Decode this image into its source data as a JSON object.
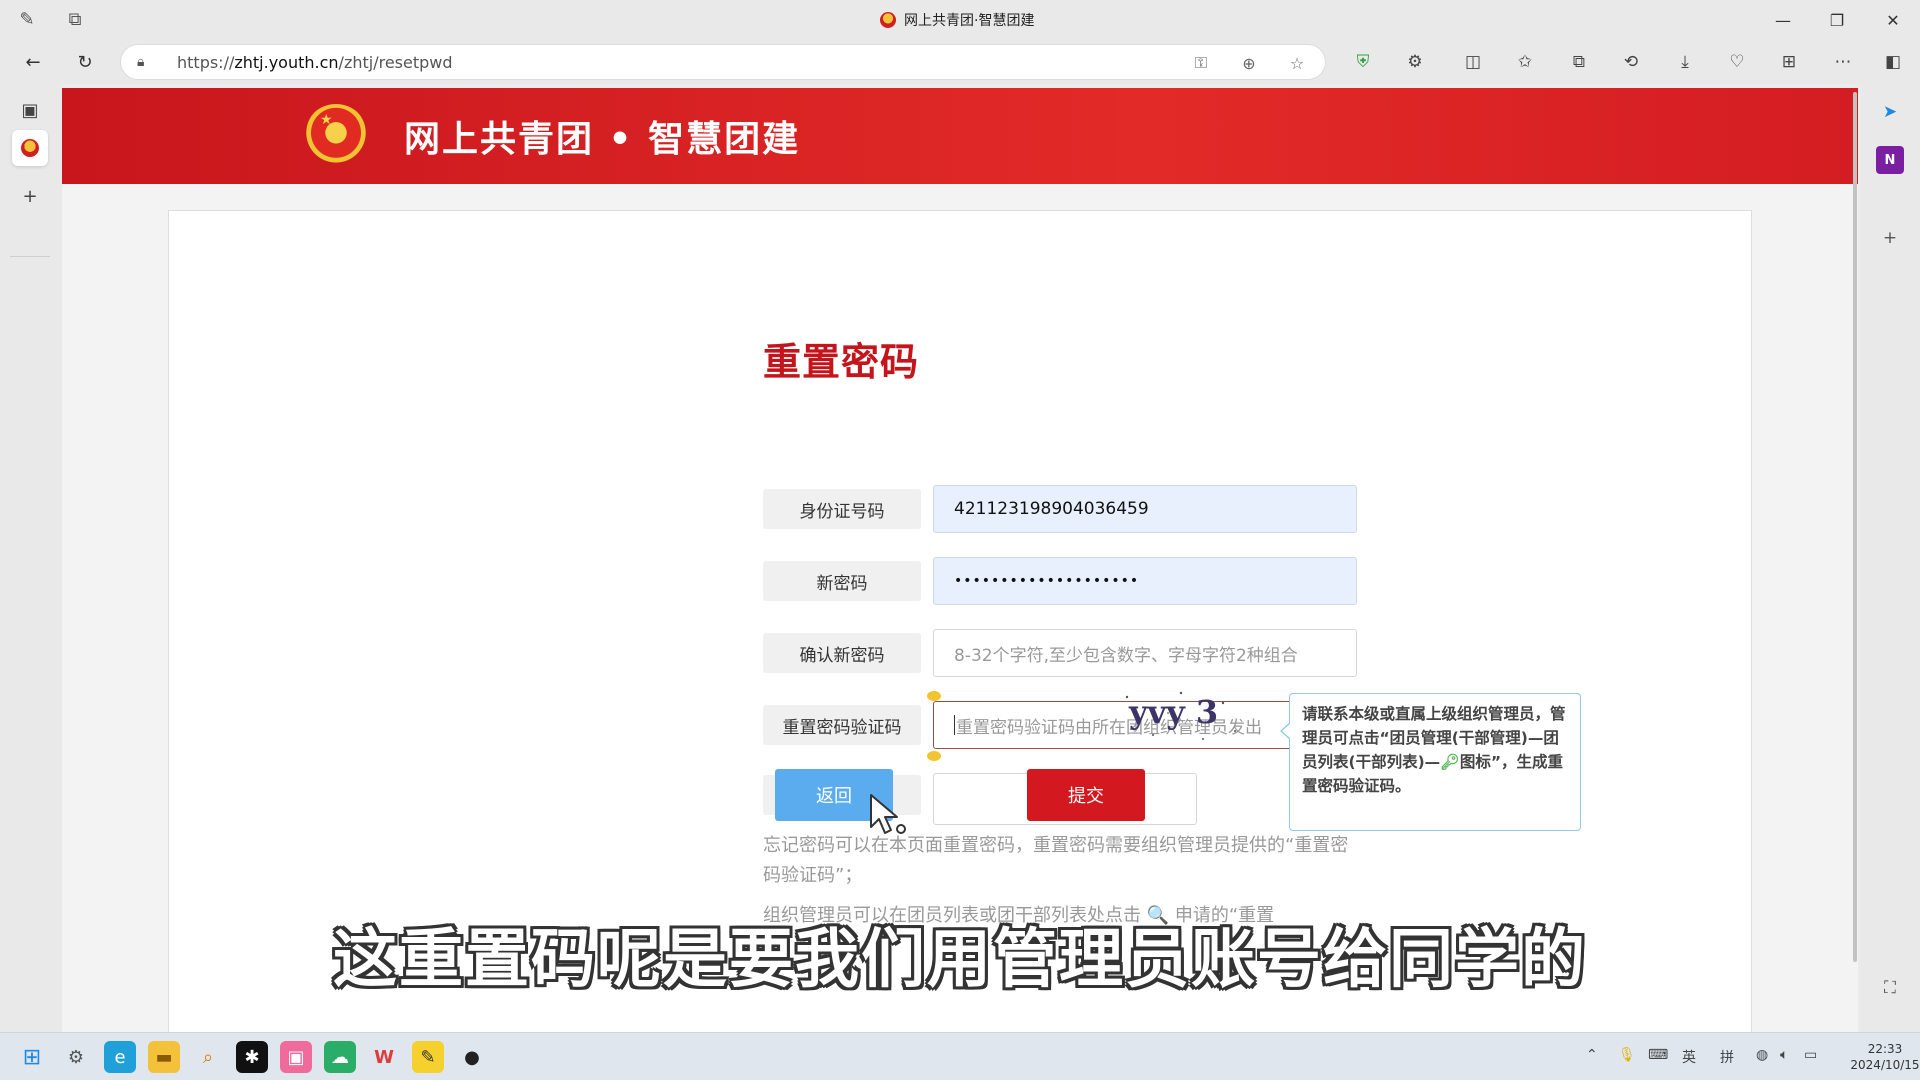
{
  "browser": {
    "tab_title": "网上共青团·智慧团建",
    "url_prefix": "https://",
    "url_host": "zhtj.youth.cn",
    "url_path": "/zhtj/resetpwd",
    "icons": {
      "back": "arrow-left-icon",
      "refresh": "refresh-icon",
      "lock": "lock-icon",
      "favorite": "star-icon",
      "zoom": "zoom-icon",
      "key": "key-icon"
    },
    "window_controls": [
      "—",
      "❐",
      "✕"
    ]
  },
  "header": {
    "site_title": "网上共青团 • 智慧团建"
  },
  "form": {
    "title": "重置密码",
    "id_label": "身份证号码",
    "id_value": "421123198904036459",
    "new_pw_label": "新密码",
    "new_pw_value": "••••••••••••••••••••",
    "confirm_pw_label": "确认新密码",
    "confirm_pw_placeholder": "8-32个字符,至少包含数字、字母字符2种组合",
    "reset_code_label": "重置密码验证码",
    "reset_code_placeholder": "重置密码验证码由所在团组织管理员发出",
    "captcha_label": "验证码",
    "captcha_value": "",
    "captcha_image_text": "yvy 3",
    "back_button": "返回",
    "submit_button": "提交"
  },
  "tooltip": {
    "line1": "请联系本级或直属上级组织管理员，管理员可点击“团员管理(干部管理)—团员列表(干部列表)—",
    "line2": "图标”，生成重置密码验证码。"
  },
  "help": {
    "p1": "忘记密码可以在本页面重置密码，重置密码需要组织管理员提供的“重置密码验证码”；",
    "p2": "组织管理员可以在团员列表或团干部列表处点击 🔍 申请的“重置"
  },
  "subtitle": "这重置码呢是要我们用管理员账号给同学的",
  "taskbar": {
    "tray_ime": "英",
    "tray_pinyin": "拼",
    "time": "22:33",
    "date": "2024/10/15"
  },
  "colors": {
    "brand_red": "#d3191f",
    "title_red": "#c3151b",
    "back_blue": "#5aacef",
    "tooltip_border": "#8ec9e6"
  }
}
